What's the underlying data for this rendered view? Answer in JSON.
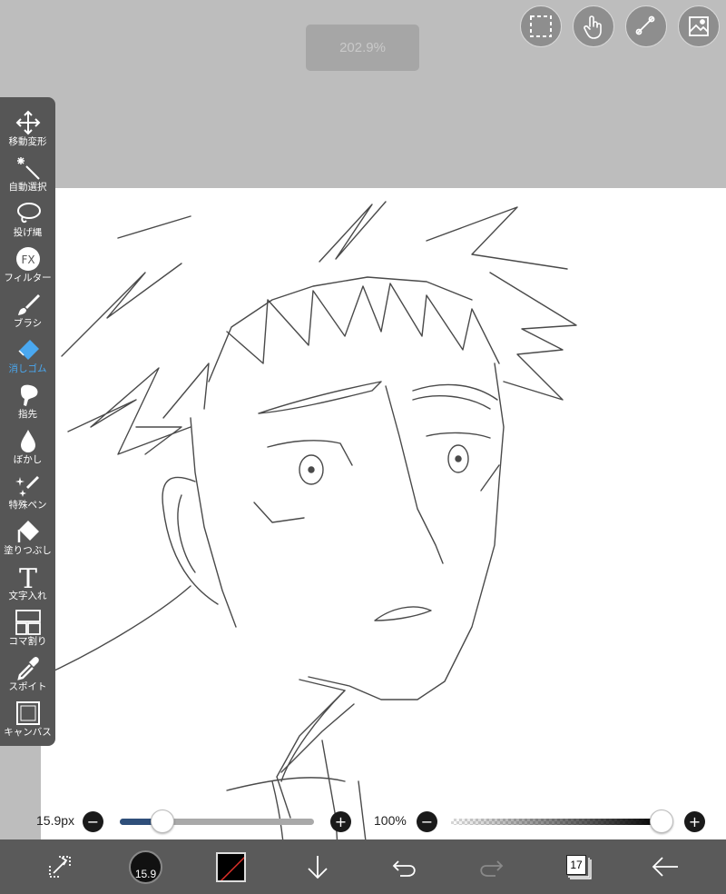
{
  "zoom": {
    "label": "202.9%"
  },
  "top_buttons": [
    {
      "name": "selection-icon"
    },
    {
      "name": "touch-icon"
    },
    {
      "name": "ruler-icon"
    },
    {
      "name": "material-icon"
    }
  ],
  "toolbar": {
    "active_color": "#4aa8f0",
    "items": [
      {
        "label": "移動変形",
        "icon": "move-icon"
      },
      {
        "label": "自動選択",
        "icon": "magic-wand-icon"
      },
      {
        "label": "投げ縄",
        "icon": "lasso-icon"
      },
      {
        "label": "フィルター",
        "icon": "filter-fx-icon"
      },
      {
        "label": "ブラシ",
        "icon": "brush-icon"
      },
      {
        "label": "消しゴム",
        "icon": "eraser-icon",
        "active": true
      },
      {
        "label": "指先",
        "icon": "finger-icon"
      },
      {
        "label": "ぼかし",
        "icon": "blur-drop-icon"
      },
      {
        "label": "特殊ペン",
        "icon": "special-pen-icon"
      },
      {
        "label": "塗りつぶし",
        "icon": "fill-bucket-icon"
      },
      {
        "label": "文字入れ",
        "icon": "text-icon"
      },
      {
        "label": "コマ割り",
        "icon": "frame-divider-icon"
      },
      {
        "label": "スポイト",
        "icon": "eyedropper-icon"
      },
      {
        "label": "キャンバス",
        "icon": "canvas-icon"
      }
    ]
  },
  "brush_size": {
    "label": "15.9px",
    "minus": "−",
    "plus": "+",
    "fraction": 0.22
  },
  "opacity": {
    "label": "100%",
    "minus": "−",
    "plus": "+",
    "fraction": 1.0
  },
  "bottom_bar": {
    "brush_size_label": "15.9",
    "layer_count": "17",
    "items": [
      "transform-icon",
      "brush-size-button",
      "color-swatch",
      "import-down-icon",
      "undo-icon",
      "redo-icon",
      "layers-button",
      "back-arrow-icon"
    ]
  }
}
